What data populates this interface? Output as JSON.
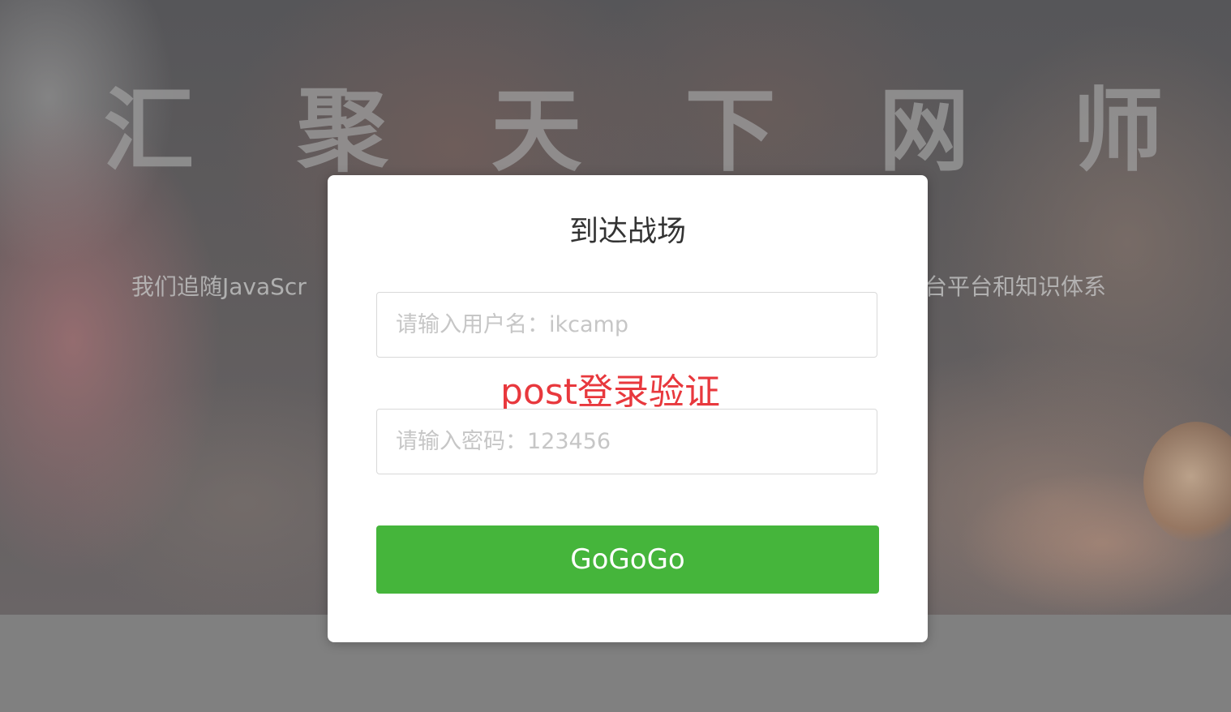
{
  "hero": {
    "title": "汇 聚 天 下 网 师",
    "subtitle_left": "我们追随JavaScr",
    "subtitle_right": "台平台和知识体系"
  },
  "login_modal": {
    "title": "到达战场",
    "username_placeholder": "请输入用户名：ikcamp",
    "password_placeholder": "请输入密码：123456",
    "submit_label": "GoGoGo",
    "annotation": "post登录验证"
  },
  "colors": {
    "submit_button": "#45b53b",
    "annotation_text": "#e8383d",
    "modal_background": "#ffffff"
  }
}
